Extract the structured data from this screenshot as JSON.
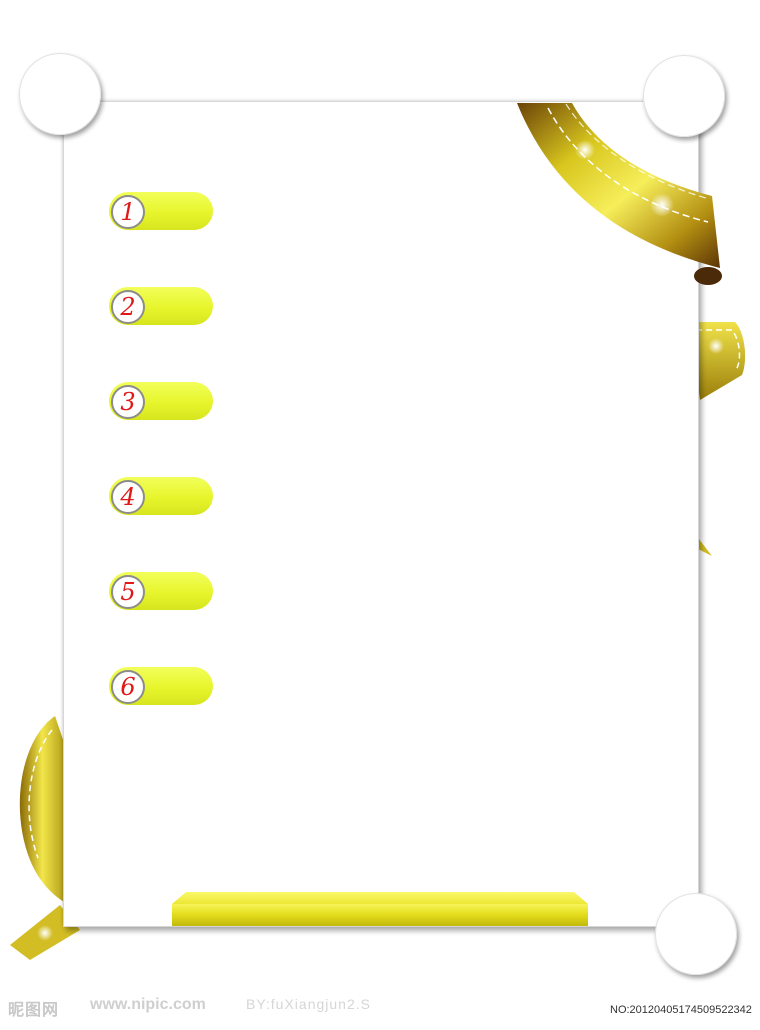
{
  "list": {
    "items": [
      {
        "number": "1"
      },
      {
        "number": "2"
      },
      {
        "number": "3"
      },
      {
        "number": "4"
      },
      {
        "number": "5"
      },
      {
        "number": "6"
      }
    ]
  },
  "colors": {
    "pill_yellow": "#e7f52c",
    "number_red": "#e01818",
    "ribbon_gold": "#c9b21a",
    "ribbon_brown": "#7a4a10"
  },
  "watermark": {
    "site_cn": "昵图网",
    "url": "www.nipic.com",
    "by": "BY:fuXiangjun2.S",
    "no": "NO:20120405174509522342"
  }
}
